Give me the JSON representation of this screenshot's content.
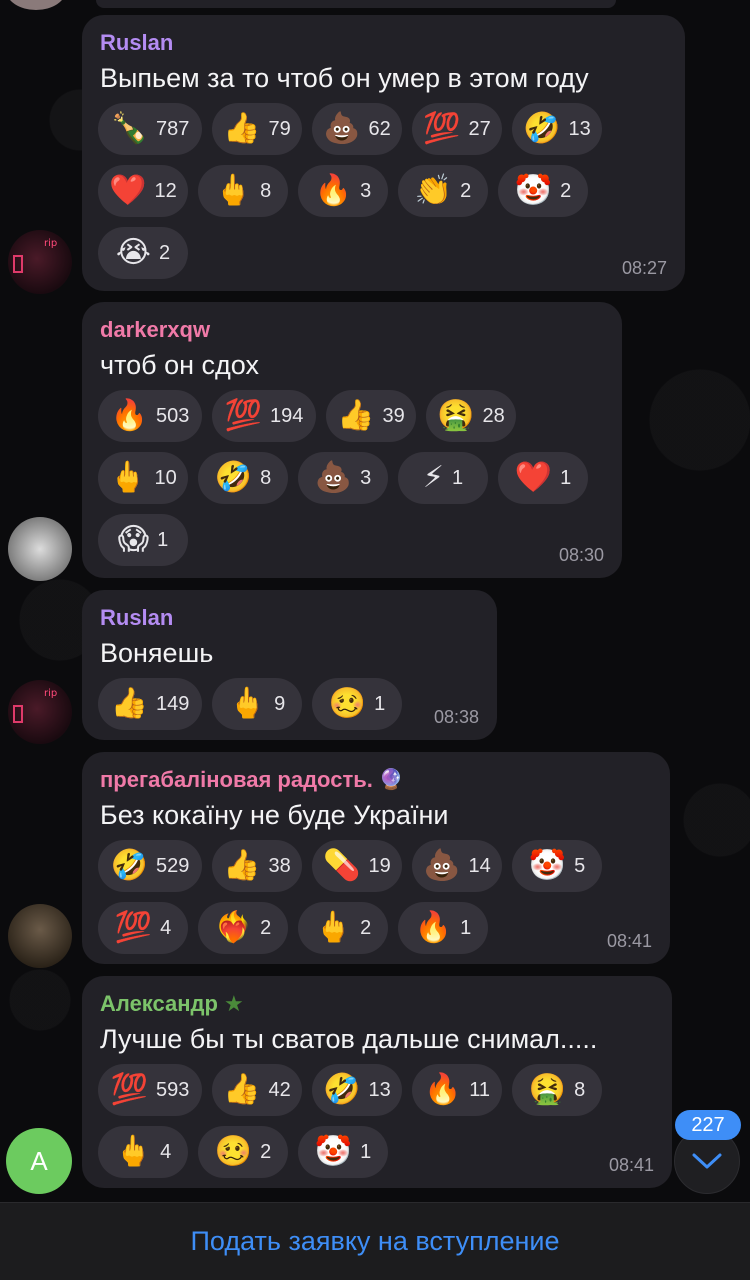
{
  "chat": {
    "messages": [
      {
        "sender": "Ruslan",
        "sender_color": "#b48cf2",
        "text": "Выпьем за то чтоб он умер в этом году",
        "time": "08:27",
        "reactions": [
          [
            {
              "emoji": "🍾",
              "count": "787"
            },
            {
              "emoji": "👍",
              "count": "79"
            },
            {
              "emoji": "💩",
              "count": "62"
            },
            {
              "emoji": "💯",
              "count": "27"
            },
            {
              "emoji": "🤣",
              "count": "13"
            }
          ],
          [
            {
              "emoji": "❤️",
              "count": "12"
            },
            {
              "emoji": "🖕",
              "count": "8"
            },
            {
              "emoji": "🔥",
              "count": "3"
            },
            {
              "emoji": "👏",
              "count": "2"
            },
            {
              "emoji": "🤡",
              "count": "2"
            }
          ],
          [
            {
              "emoji": "😭",
              "count": "2"
            }
          ]
        ]
      },
      {
        "sender": "darkerxqw",
        "sender_color": "#f07aa8",
        "text": "чтоб он сдох",
        "time": "08:30",
        "reactions": [
          [
            {
              "emoji": "🔥",
              "count": "503"
            },
            {
              "emoji": "💯",
              "count": "194"
            },
            {
              "emoji": "👍",
              "count": "39"
            },
            {
              "emoji": "🤮",
              "count": "28"
            }
          ],
          [
            {
              "emoji": "🖕",
              "count": "10"
            },
            {
              "emoji": "🤣",
              "count": "8"
            },
            {
              "emoji": "💩",
              "count": "3"
            },
            {
              "emoji": "⚡",
              "count": "1"
            },
            {
              "emoji": "❤️",
              "count": "1"
            }
          ],
          [
            {
              "emoji": "😱",
              "count": "1"
            }
          ]
        ]
      },
      {
        "sender": "Ruslan",
        "sender_color": "#b48cf2",
        "text": "Воняешь",
        "time": "08:38",
        "reactions": [
          [
            {
              "emoji": "👍",
              "count": "149"
            },
            {
              "emoji": "🖕",
              "count": "9"
            },
            {
              "emoji": "🥴",
              "count": "1"
            }
          ]
        ]
      },
      {
        "sender": "прегабаліновая радость.",
        "sender_badge": "🔮",
        "sender_color": "#f07aa8",
        "text": "Без кокаїну не буде України",
        "time": "08:41",
        "reactions": [
          [
            {
              "emoji": "🤣",
              "count": "529"
            },
            {
              "emoji": "👍",
              "count": "38"
            },
            {
              "emoji": "💊",
              "count": "19"
            },
            {
              "emoji": "💩",
              "count": "14"
            },
            {
              "emoji": "🤡",
              "count": "5"
            }
          ],
          [
            {
              "emoji": "💯",
              "count": "4"
            },
            {
              "emoji": "❤️‍🔥",
              "count": "2"
            },
            {
              "emoji": "🖕",
              "count": "2"
            },
            {
              "emoji": "🔥",
              "count": "1"
            }
          ]
        ]
      },
      {
        "sender": "Александр",
        "sender_badge": "★",
        "sender_color": "#7cc36a",
        "text": "Лучше бы ты сватов дальше снимал.....",
        "time": "08:41",
        "reactions": [
          [
            {
              "emoji": "💯",
              "count": "593"
            },
            {
              "emoji": "👍",
              "count": "42"
            },
            {
              "emoji": "🤣",
              "count": "13"
            },
            {
              "emoji": "🔥",
              "count": "11"
            },
            {
              "emoji": "🤮",
              "count": "8"
            }
          ],
          [
            {
              "emoji": "🖕",
              "count": "4"
            },
            {
              "emoji": "🥴",
              "count": "2"
            },
            {
              "emoji": "🤡",
              "count": "1"
            }
          ]
        ]
      }
    ]
  },
  "avatar_letter": "A",
  "unread_count": "227",
  "join_request_label": "Подать заявку на вступление",
  "icons": {
    "scroll_down": "chevron-down-icon"
  }
}
